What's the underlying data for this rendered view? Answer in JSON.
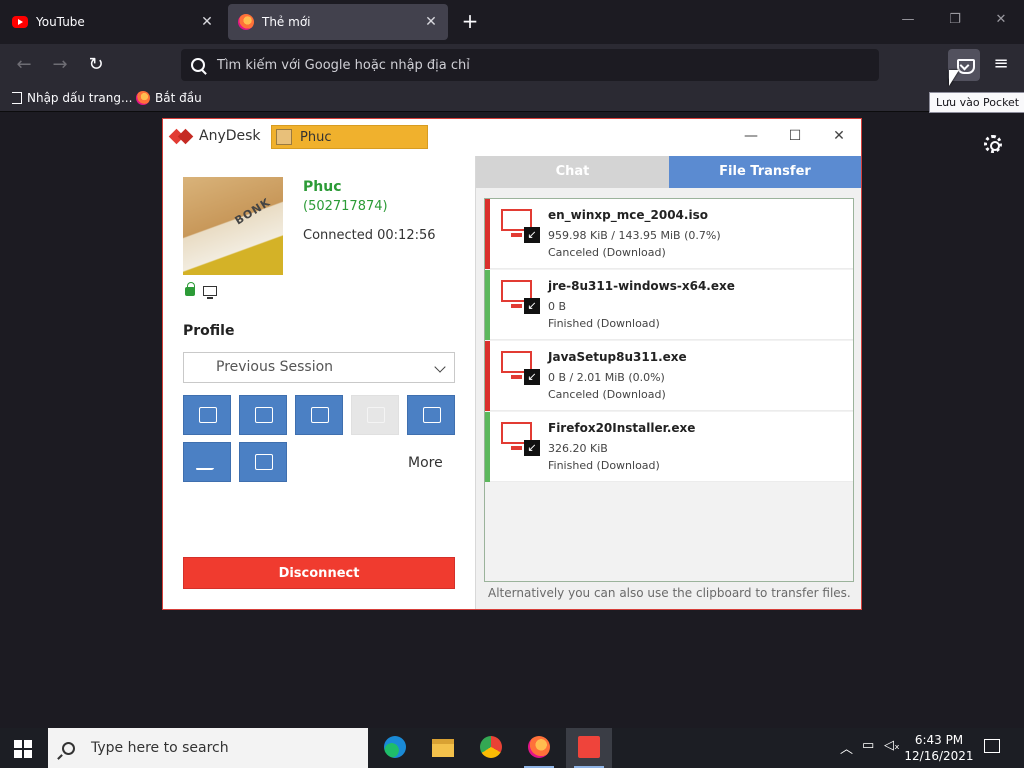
{
  "browser": {
    "tabs": [
      {
        "title": "YouTube",
        "active": false
      },
      {
        "title": "Thẻ mới",
        "active": true
      }
    ],
    "new_tab": "+",
    "url_placeholder": "Tìm kiếm với Google hoặc nhập địa chỉ",
    "bookmarks": [
      {
        "label": "Nhập dấu trang..."
      },
      {
        "label": "Bắt đầu"
      }
    ],
    "tooltip": "Lưu vào Pocket"
  },
  "anydesk": {
    "app_name": "AnyDesk",
    "session_tab": "Phuc",
    "peer_name": "Phuc",
    "peer_id": "(502717874)",
    "connection_status": "Connected 00:12:56",
    "avatar_text": "BONK",
    "profile_label": "Profile",
    "profile_value": "Previous Session",
    "more_label": "More",
    "disconnect_label": "Disconnect",
    "tabs": {
      "chat": "Chat",
      "file_transfer": "File Transfer"
    },
    "transfers": [
      {
        "name": "en_winxp_mce_2004.iso",
        "size": "959.98 KiB / 143.95 MiB (0.7%)",
        "status": "Canceled (Download)",
        "state_color": "#d9302c"
      },
      {
        "name": "jre-8u311-windows-x64.exe",
        "size": "0 B",
        "status": "Finished (Download)",
        "state_color": "#5cb85c"
      },
      {
        "name": "JavaSetup8u311.exe",
        "size": "0 B / 2.01 MiB (0.0%)",
        "status": "Canceled (Download)",
        "state_color": "#d9302c"
      },
      {
        "name": "Firefox20Installer.exe",
        "size": "326.20 KiB",
        "status": "Finished (Download)",
        "state_color": "#5cb85c"
      }
    ],
    "hint": "Alternatively you can also use the clipboard to transfer files."
  },
  "taskbar": {
    "search_placeholder": "Type here to search",
    "time": "6:43 PM",
    "date": "12/16/2021"
  }
}
